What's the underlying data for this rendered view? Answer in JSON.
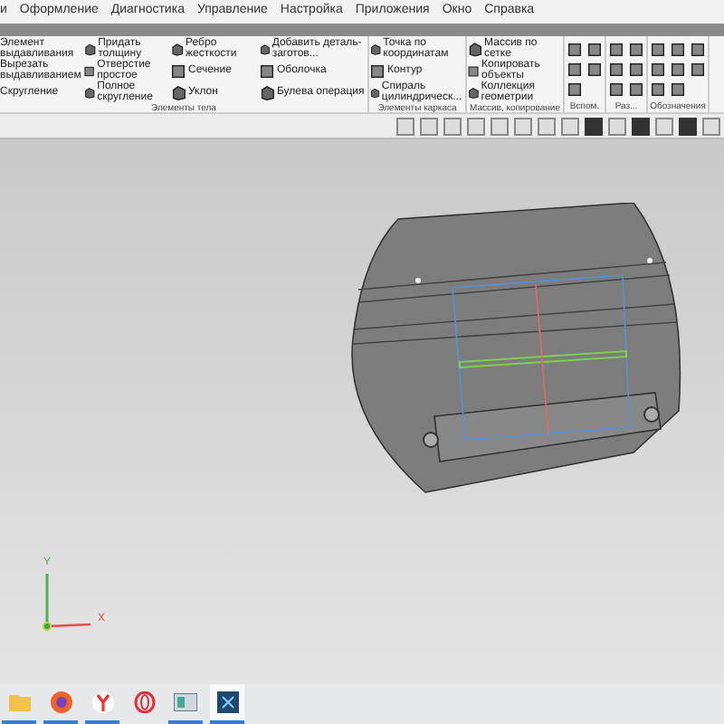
{
  "menu": [
    "и",
    "Оформление",
    "Диагностика",
    "Управление",
    "Настройка",
    "Приложения",
    "Окно",
    "Справка"
  ],
  "ribbon_groups": [
    {
      "label": "Элементы тела",
      "columns": [
        [
          "Элемент выдавливания",
          "Вырезать выдавливанием",
          "Скругление"
        ],
        [
          "Придать толщину",
          "Отверстие простое",
          "Полное скругление"
        ],
        [
          "Ребро жесткости",
          "Сечение",
          "Уклон"
        ],
        [
          "Добавить деталь-заготов...",
          "Оболочка",
          "Булева операция"
        ]
      ]
    },
    {
      "label": "Элементы каркаса",
      "columns": [
        [
          "Точка по координатам",
          "Контур",
          "Спираль цилиндрическ..."
        ]
      ]
    },
    {
      "label": "Массив, копирование",
      "columns": [
        [
          "Массив по сетке",
          "Копировать объекты",
          "Коллекция геометрии"
        ]
      ]
    }
  ],
  "icon_groups": [
    {
      "label": "Вспом."
    },
    {
      "label": "Раз..."
    },
    {
      "label": "Обозначения"
    }
  ],
  "viewport": {
    "axis_labels": [
      "Y",
      "X"
    ]
  },
  "taskbar": [
    {
      "kind": "folder",
      "running": true,
      "selected": false
    },
    {
      "kind": "firefox",
      "running": true,
      "selected": false
    },
    {
      "kind": "yandex",
      "running": true,
      "selected": false
    },
    {
      "kind": "opera",
      "running": false,
      "selected": false
    },
    {
      "kind": "window",
      "running": true,
      "selected": false
    },
    {
      "kind": "cad",
      "running": true,
      "selected": true
    }
  ]
}
